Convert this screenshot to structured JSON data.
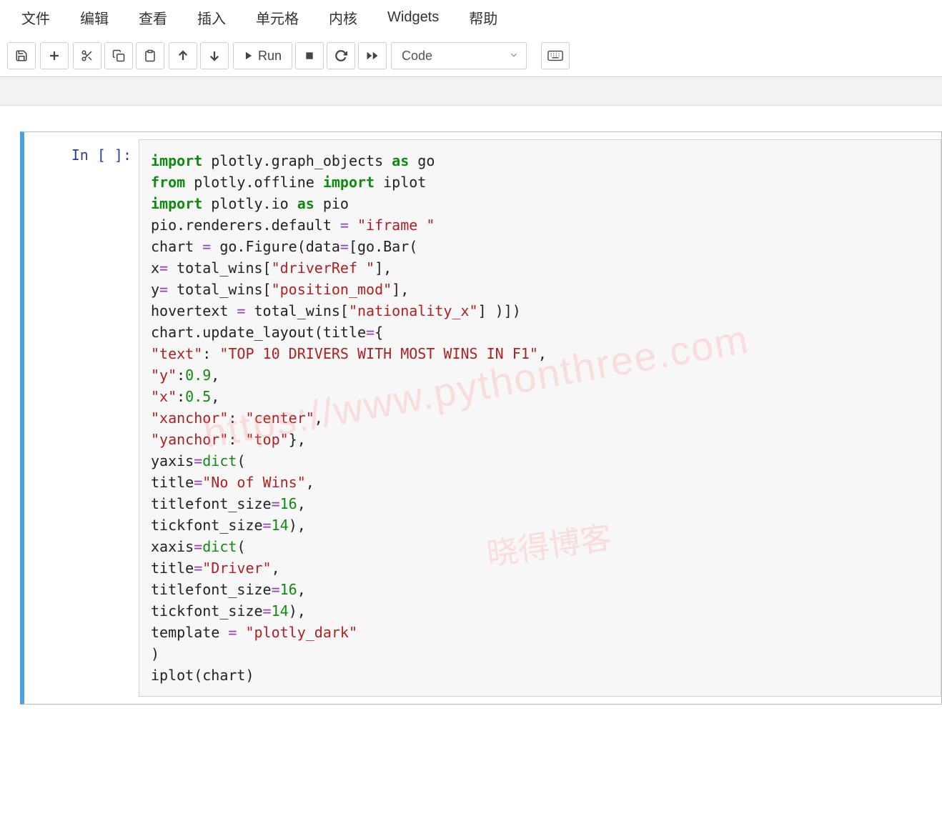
{
  "menu": {
    "file": "文件",
    "edit": "编辑",
    "view": "查看",
    "insert": "插入",
    "cell": "单元格",
    "kernel": "内核",
    "widgets": "Widgets",
    "help": "帮助"
  },
  "toolbar": {
    "run_label": "Run",
    "cell_type": "Code"
  },
  "cell_prompt": "In [ ]:",
  "code": {
    "l1a": "import",
    "l1b": " plotly.graph_objects ",
    "l1c": "as",
    "l1d": " go",
    "l2a": "from",
    "l2b": " plotly.offline ",
    "l2c": "import",
    "l2d": " iplot",
    "l3a": "import",
    "l3b": " plotly.io ",
    "l3c": "as",
    "l3d": " pio",
    "l4a": "pio.renderers.default ",
    "l4b": "=",
    "l4c": " ",
    "l4d": "\"iframe \"",
    "l5a": "chart ",
    "l5b": "=",
    "l5c": " go.Figure(data",
    "l5d": "=",
    "l5e": "[go.Bar(",
    "l6a": "x",
    "l6b": "=",
    "l6c": " total_wins[",
    "l6d": "\"driverRef \"",
    "l6e": "],",
    "l7a": "y",
    "l7b": "=",
    "l7c": " total_wins[",
    "l7d": "\"position_mod\"",
    "l7e": "],",
    "l8a": "hovertext ",
    "l8b": "=",
    "l8c": " total_wins[",
    "l8d": "\"nationality_x\"",
    "l8e": "] )])",
    "l9a": "chart.update_layout(title",
    "l9b": "=",
    "l9c": "{",
    "l10a": "\"text\"",
    "l10b": ": ",
    "l10c": "\"TOP 10 DRIVERS WITH MOST WINS IN F1\"",
    "l10d": ",",
    "l11a": "\"y\"",
    "l11b": ":",
    "l11c": "0.9",
    "l11d": ",",
    "l12a": "\"x\"",
    "l12b": ":",
    "l12c": "0.5",
    "l12d": ",",
    "l13a": "\"xanchor\"",
    "l13b": ": ",
    "l13c": "\"center\"",
    "l13d": ",",
    "l14a": "\"yanchor\"",
    "l14b": ": ",
    "l14c": "\"top\"",
    "l14d": "},",
    "l15a": "yaxis",
    "l15b": "=",
    "l15c": "dict",
    "l15d": "(",
    "l16a": "title",
    "l16b": "=",
    "l16c": "\"No of Wins\"",
    "l16d": ",",
    "l17a": "titlefont_size",
    "l17b": "=",
    "l17c": "16",
    "l17d": ",",
    "l18a": "tickfont_size",
    "l18b": "=",
    "l18c": "14",
    "l18d": "),",
    "l19a": "xaxis",
    "l19b": "=",
    "l19c": "dict",
    "l19d": "(",
    "l20a": "title",
    "l20b": "=",
    "l20c": "\"Driver\"",
    "l20d": ",",
    "l21a": "titlefont_size",
    "l21b": "=",
    "l21c": "16",
    "l21d": ",",
    "l22a": "tickfont_size",
    "l22b": "=",
    "l22c": "14",
    "l22d": "),",
    "l23a": "template ",
    "l23b": "=",
    "l23c": " ",
    "l23d": "\"plotly_dark\"",
    "l24": ")",
    "l25": "iplot(chart)"
  },
  "watermark": {
    "url": "https://www.pythonthree.com",
    "text": "晓得博客"
  }
}
